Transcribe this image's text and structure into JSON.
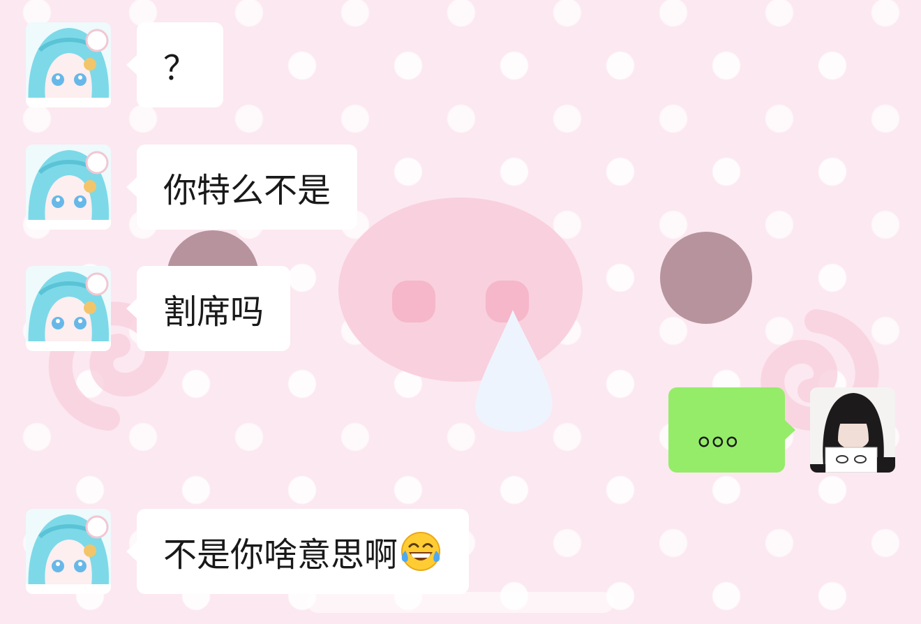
{
  "colors": {
    "wallpaper": "#fce8f0",
    "incoming_bubble": "#ffffff",
    "outgoing_bubble": "#95ec69",
    "text": "#191919"
  },
  "messages": [
    {
      "side": "incoming",
      "text": "？",
      "avatar": "anime-girl-avatar-icon"
    },
    {
      "side": "incoming",
      "text": "你特么不是",
      "avatar": "anime-girl-avatar-icon"
    },
    {
      "side": "incoming",
      "text": "割席吗",
      "avatar": "anime-girl-avatar-icon"
    },
    {
      "side": "outgoing",
      "text": "。。。",
      "avatar": "user-photo-avatar-icon"
    },
    {
      "side": "incoming",
      "text": "不是你啥意思啊",
      "emoji": "tears-of-joy-emoji-icon",
      "avatar": "anime-girl-avatar-icon"
    }
  ]
}
